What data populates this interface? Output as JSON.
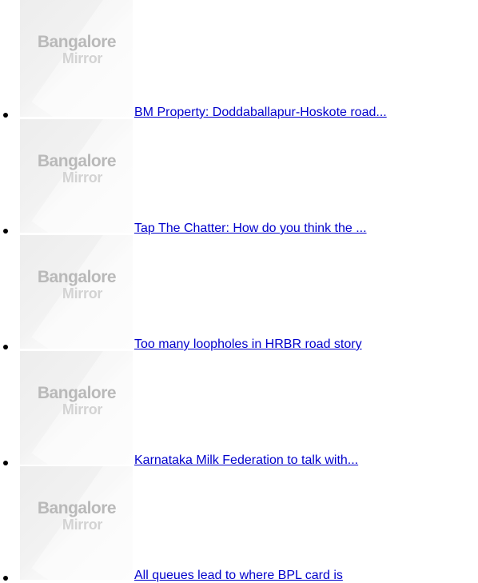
{
  "logo": {
    "line1": "Bangalore",
    "line2": "Mirror"
  },
  "articles": [
    {
      "title": "BM Property: Doddaballapur-Hoskote road..."
    },
    {
      "title": "Tap The Chatter: How do you think the ..."
    },
    {
      "title": "Too many loopholes in HRBR road story"
    },
    {
      "title": "Karnataka Milk Federation to talk with..."
    },
    {
      "title": "All queues lead to where BPL card is"
    }
  ],
  "colors": {
    "link": "#0000cc",
    "logo_primary": "#b9b9b9",
    "logo_secondary": "#d3d3d3"
  }
}
